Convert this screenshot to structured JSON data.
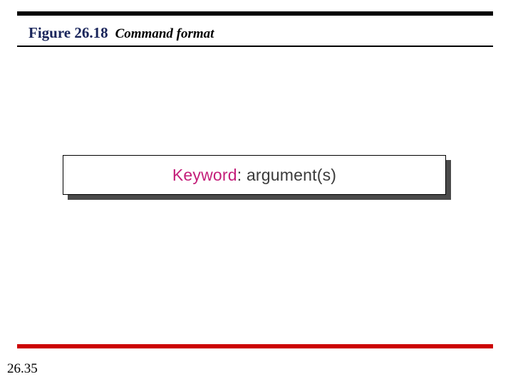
{
  "figure": {
    "number": "Figure 26.18",
    "title": "Command format"
  },
  "command": {
    "keyword": "Keyword",
    "separator": ": ",
    "argument": "argument(s)"
  },
  "page_number": "26.35"
}
